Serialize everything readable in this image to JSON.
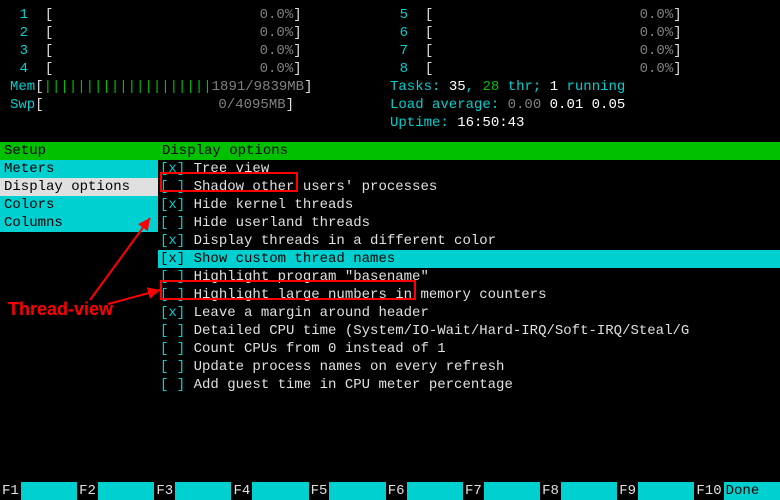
{
  "cpu_left": [
    {
      "n": "1",
      "pct": "0.0%"
    },
    {
      "n": "2",
      "pct": "0.0%"
    },
    {
      "n": "3",
      "pct": "0.0%"
    },
    {
      "n": "4",
      "pct": "0.0%"
    }
  ],
  "cpu_right": [
    {
      "n": "5",
      "pct": "0.0%"
    },
    {
      "n": "6",
      "pct": "0.0%"
    },
    {
      "n": "7",
      "pct": "0.0%"
    },
    {
      "n": "8",
      "pct": "0.0%"
    }
  ],
  "mem": {
    "label": "Mem",
    "bars": "||||||||||||||||||||",
    "value": "1891/9839MB"
  },
  "swp": {
    "label": "Swp",
    "value": "0/4095MB"
  },
  "tasks": {
    "label": "Tasks:",
    "count": "35",
    "sep1": ",",
    "thr": "28",
    "thr_lbl": "thr;",
    "run": "1",
    "run_lbl": "running"
  },
  "loadavg": {
    "label": "Load average:",
    "v1": "0.00",
    "v2": "0.01",
    "v3": "0.05"
  },
  "uptime": {
    "label": "Uptime:",
    "value": "16:50:43"
  },
  "sidebar": {
    "header": "Setup",
    "items": [
      "Meters",
      "Display options",
      "Colors",
      "Columns"
    ],
    "selected_index": 1
  },
  "main": {
    "header": "Display options",
    "options": [
      {
        "checked": true,
        "label": "Tree view"
      },
      {
        "checked": false,
        "label": "Shadow other users' processes"
      },
      {
        "checked": true,
        "label": "Hide kernel threads"
      },
      {
        "checked": false,
        "label": "Hide userland threads"
      },
      {
        "checked": true,
        "label": "Display threads in a different color"
      },
      {
        "checked": true,
        "label": "Show custom thread names"
      },
      {
        "checked": false,
        "label": "Highlight program \"basename\""
      },
      {
        "checked": false,
        "label": "Highlight large numbers in memory counters"
      },
      {
        "checked": true,
        "label": "Leave a margin around header"
      },
      {
        "checked": false,
        "label": "Detailed CPU time (System/IO-Wait/Hard-IRQ/Soft-IRQ/Steal/G"
      },
      {
        "checked": false,
        "label": "Count CPUs from 0 instead of 1"
      },
      {
        "checked": false,
        "label": "Update process names on every refresh"
      },
      {
        "checked": false,
        "label": "Add guest time in CPU meter percentage"
      }
    ],
    "selected_index": 5
  },
  "annotation": "Thread-view",
  "fkeys": [
    {
      "key": "F1",
      "label": ""
    },
    {
      "key": "F2",
      "label": ""
    },
    {
      "key": "F3",
      "label": ""
    },
    {
      "key": "F4",
      "label": ""
    },
    {
      "key": "F5",
      "label": ""
    },
    {
      "key": "F6",
      "label": ""
    },
    {
      "key": "F7",
      "label": ""
    },
    {
      "key": "F8",
      "label": ""
    },
    {
      "key": "F9",
      "label": ""
    },
    {
      "key": "F10",
      "label": "Done"
    }
  ]
}
